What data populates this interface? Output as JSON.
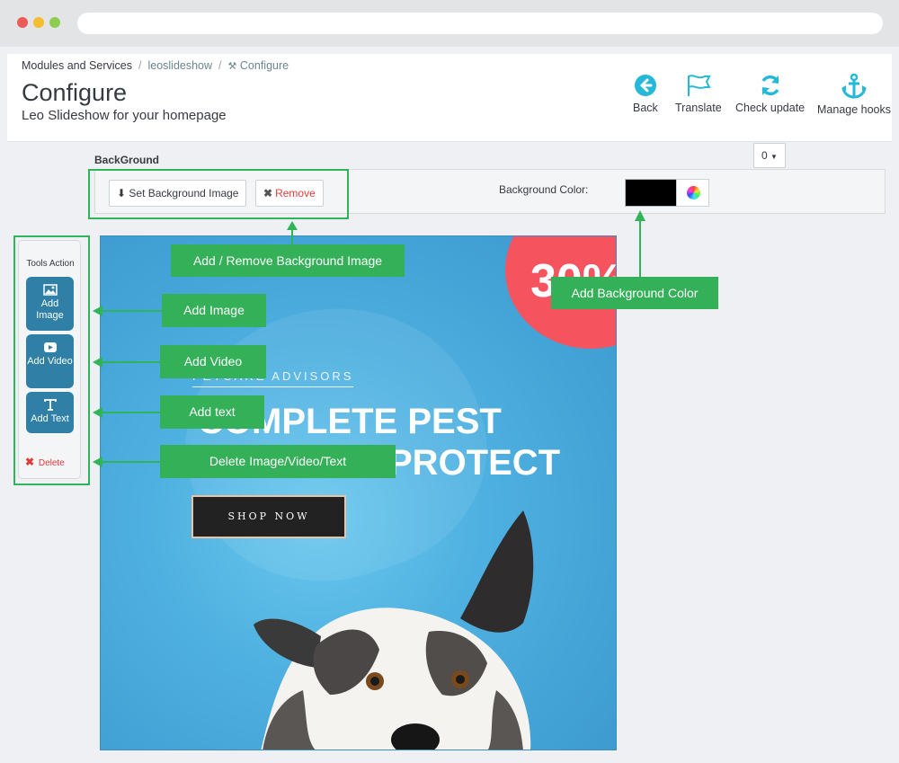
{
  "breadcrumb": {
    "item1": "Modules and Services",
    "item2": "leoslideshow",
    "item3": "Configure"
  },
  "header": {
    "title": "Configure",
    "subtitle": "Leo Slideshow for your homepage"
  },
  "toolbar": {
    "back": "Back",
    "translate": "Translate",
    "check_update": "Check update",
    "manage_hooks": "Manage hooks"
  },
  "background": {
    "section_title": "BackGround",
    "set_button": "Set Background Image",
    "remove_button": "Remove",
    "color_label": "Background Color:",
    "color_value": "#000000",
    "dropdown_value": "0"
  },
  "tools": {
    "title": "Tools Action",
    "add_image": "Add Image",
    "add_video": "Add Video",
    "add_text": "Add Text",
    "delete": "Delete"
  },
  "slide": {
    "percent": "30%",
    "tagline": "PETCARE ADVISORS",
    "headline1": "COMPLETE PEST",
    "headline2": "PROTECT",
    "button": "SHOP NOW"
  },
  "annotations": {
    "bg_image": "Add / Remove Background Image",
    "bg_color": "Add Background Color",
    "add_image": "Add Image",
    "add_video": "Add Video",
    "add_text": "Add text",
    "delete": "Delete Image/Video/Text"
  },
  "colors": {
    "accent_blue": "#2f7fa6",
    "annotation_green": "#34b058",
    "danger_red": "#e03b3b"
  }
}
